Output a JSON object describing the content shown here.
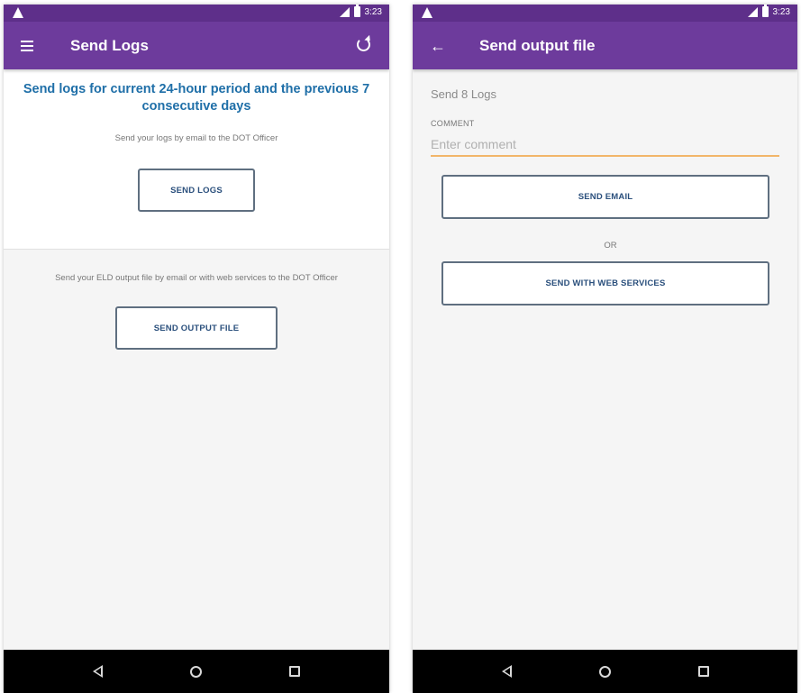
{
  "status_bar": {
    "time": "3:23"
  },
  "left_screen": {
    "title": "Send Logs",
    "headline": "Send logs for current 24-hour period and the previous 7 consecutive days",
    "email_hint": "Send your logs by email to the DOT Officer",
    "send_logs_label": "SEND LOGS",
    "output_hint": "Send your ELD output file by email or with web services to the DOT Officer",
    "send_output_label": "SEND OUTPUT FILE"
  },
  "right_screen": {
    "title": "Send output file",
    "subtitle": "Send 8 Logs",
    "comment_label": "COMMENT",
    "comment_placeholder": "Enter comment",
    "comment_value": "",
    "send_email_label": "SEND EMAIL",
    "or_text": "OR",
    "send_web_label": "SEND WITH WEB SERVICES"
  },
  "colors": {
    "status_bar": "#5e2f8a",
    "app_bar": "#6d3b9c",
    "headline": "#1f6fa8",
    "button_text": "#2a4f7c",
    "input_underline": "#f2b66a"
  },
  "icons": {
    "status": [
      "warning-icon",
      "signal-icon",
      "battery-icon"
    ],
    "left_app_bar": [
      "menu-icon",
      "refresh-icon"
    ],
    "right_app_bar": [
      "back-arrow-icon"
    ],
    "nav": [
      "nav-back-icon",
      "nav-home-icon",
      "nav-recent-icon"
    ]
  }
}
